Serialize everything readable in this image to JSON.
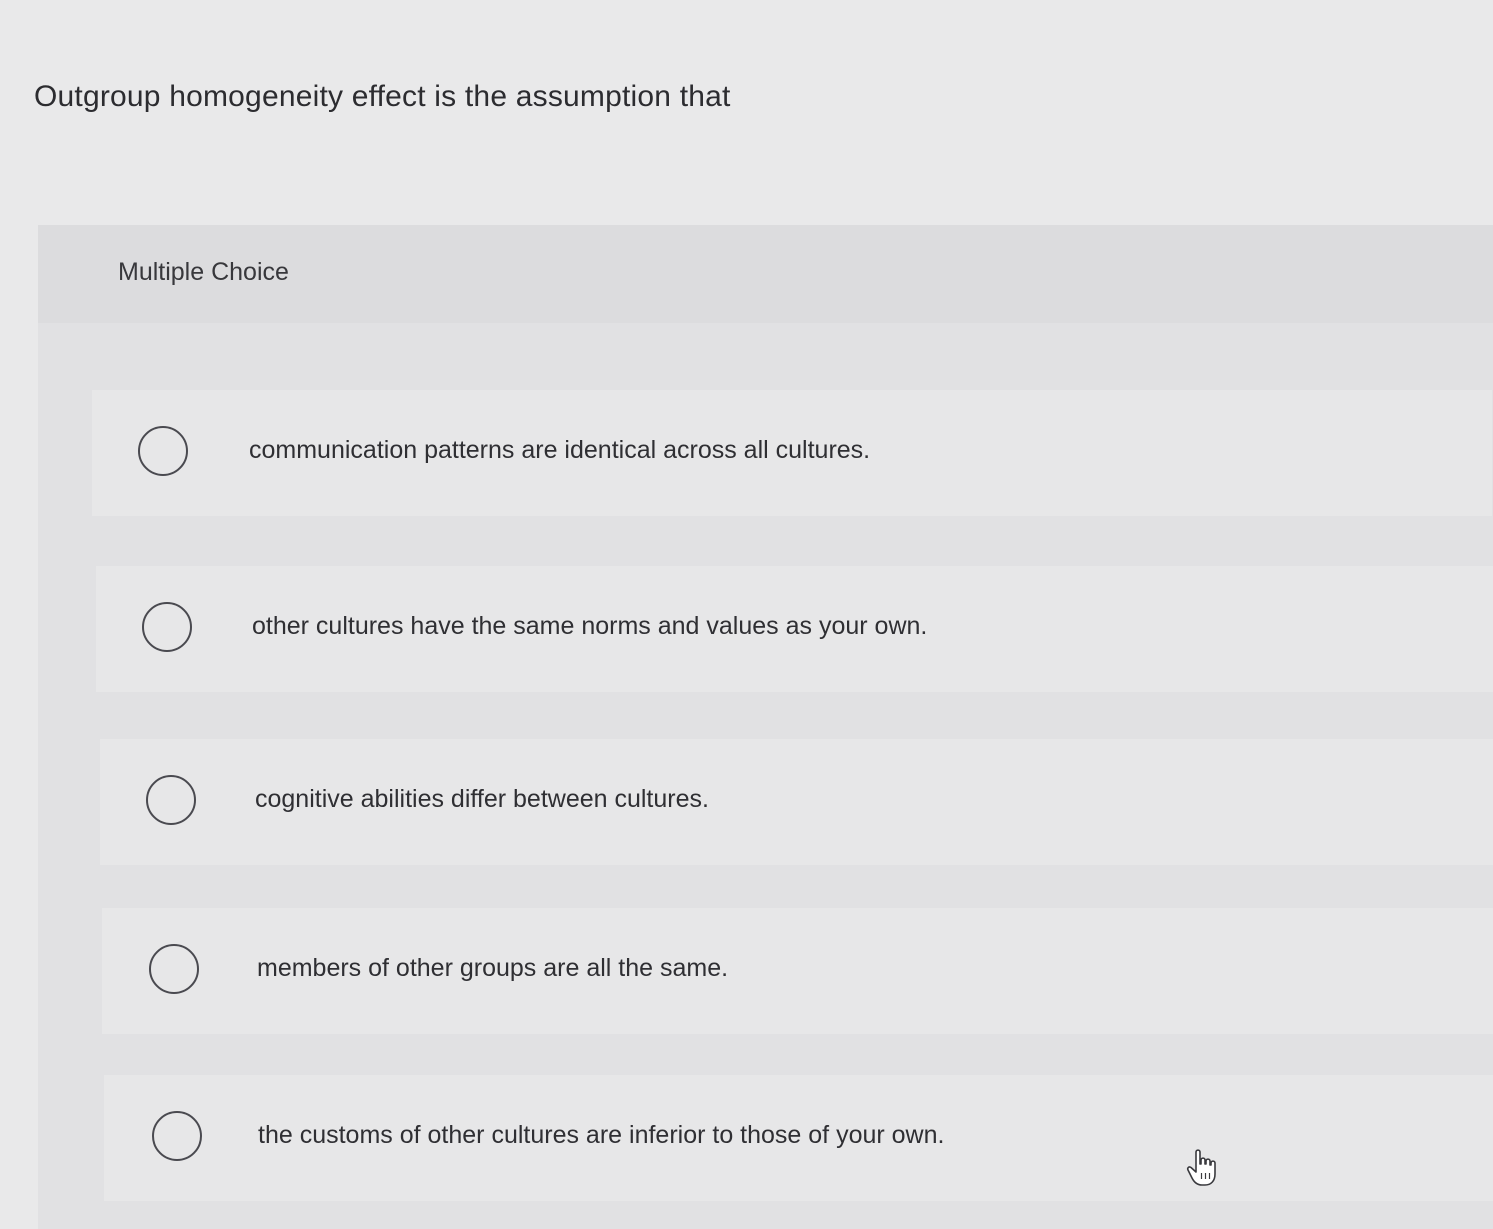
{
  "question": {
    "text": "Outgroup homogeneity effect is the assumption that"
  },
  "multiple_choice": {
    "label": "Multiple Choice",
    "options": [
      {
        "text": "communication patterns are identical across all cultures.",
        "selected": false
      },
      {
        "text": "other cultures have the same norms and values as your own.",
        "selected": false
      },
      {
        "text": "cognitive abilities differ between cultures.",
        "selected": false
      },
      {
        "text": "members of other groups are all the same.",
        "selected": false
      },
      {
        "text": "the customs of other cultures are inferior to those of your own.",
        "selected": false
      }
    ]
  },
  "icons": {
    "radio": "radio-button-icon",
    "cursor": "hand-pointer-icon"
  },
  "colors": {
    "background": "#e9e9ea",
    "panel": "#e1e1e3",
    "option_background": "#e7e7e8",
    "text": "#2f2f33",
    "radio_border": "#4a4a50"
  }
}
